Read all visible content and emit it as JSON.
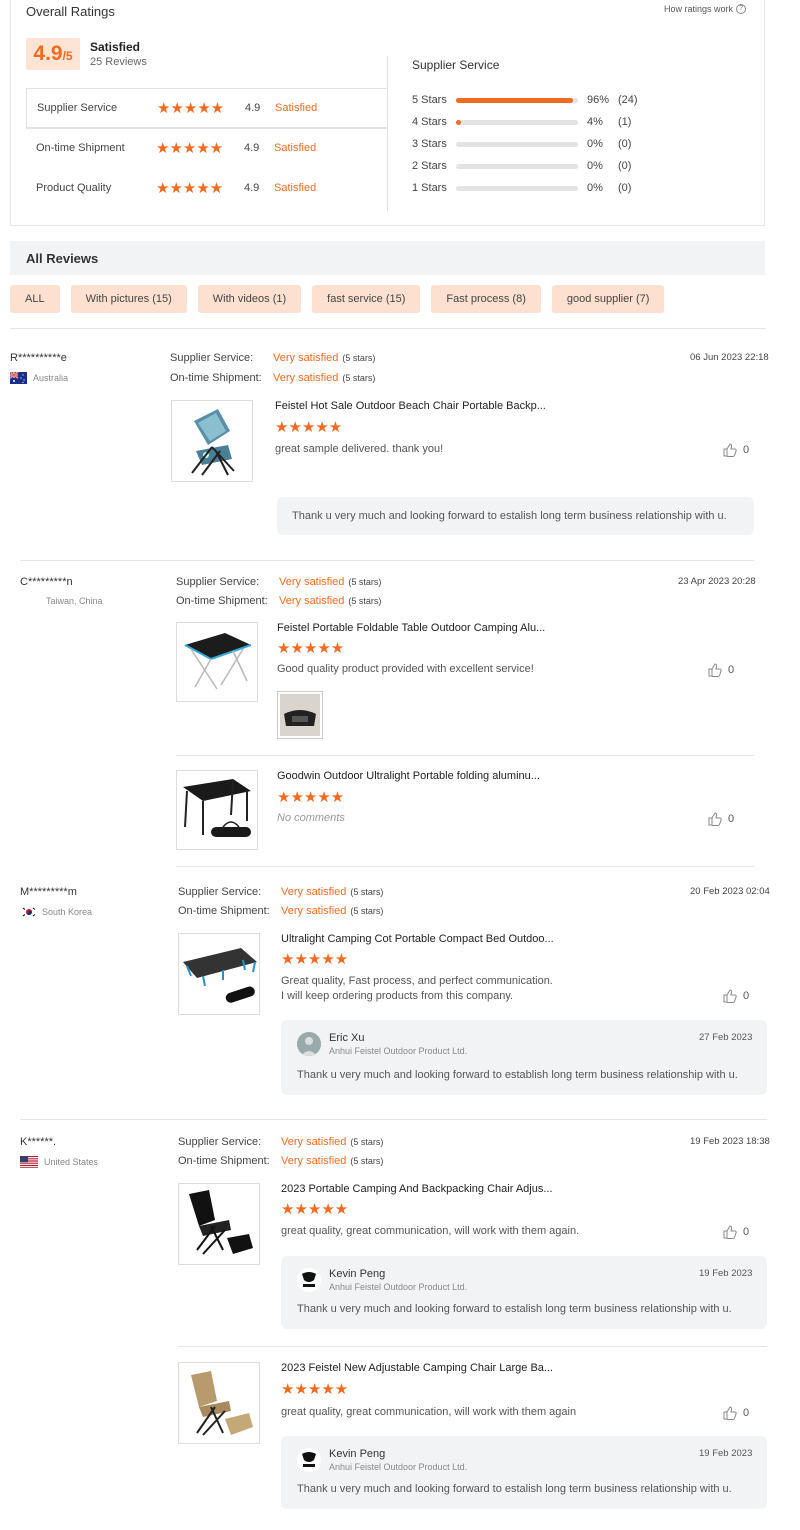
{
  "overall": {
    "title": "Overall Ratings",
    "how_link": "How ratings work",
    "score": "4.9",
    "score_out": "/5",
    "summary": "Satisfied",
    "review_count": "25 Reviews",
    "rows": [
      {
        "label": "Supplier Service",
        "score": "4.9",
        "status": "Satisfied"
      },
      {
        "label": "On-time Shipment",
        "score": "4.9",
        "status": "Satisfied"
      },
      {
        "label": "Product Quality",
        "score": "4.9",
        "status": "Satisfied"
      }
    ]
  },
  "supplier": {
    "title": "Supplier Service",
    "bars": [
      {
        "label": "5 Stars",
        "fraction": 0.96,
        "pct": "96%",
        "count": "(24)"
      },
      {
        "label": "4 Stars",
        "fraction": 0.04,
        "pct": "4%",
        "count": "(1)"
      },
      {
        "label": "3 Stars",
        "fraction": 0,
        "pct": "0%",
        "count": "(0)"
      },
      {
        "label": "2 Stars",
        "fraction": 0,
        "pct": "0%",
        "count": "(0)"
      },
      {
        "label": "1 Stars",
        "fraction": 0,
        "pct": "0%",
        "count": "(0)"
      }
    ]
  },
  "all_reviews": {
    "title": "All Reviews",
    "filters": [
      "ALL",
      "With pictures (15)",
      "With videos (1)",
      "fast service (15)",
      "Fast process (8)",
      "good supplier (7)"
    ]
  },
  "labels": {
    "supplier_service": "Supplier Service:",
    "ontime": "On-time Shipment:",
    "very_satisfied": "Very satisfied",
    "five_stars": "(5 stars)"
  },
  "accent": "#f06b22",
  "reviews": [
    {
      "name": "R**********e",
      "country": "Australia",
      "date": "06 Jun 2023 22:18",
      "products": [
        {
          "title": "Feistel Hot Sale Outdoor Beach Chair Portable Backp...",
          "comment": "great sample delivered. thank you!",
          "likes": "0"
        }
      ],
      "reply": "Thank u very much and looking forward to estalish long term business relationship with u."
    },
    {
      "name": "C*********n",
      "country": "Taiwan, China",
      "date": "23 Apr 2023 20:28",
      "products": [
        {
          "title": "Feistel Portable Foldable Table Outdoor Camping Alu...",
          "comment": "Good quality product provided with excellent service!",
          "likes": "0"
        },
        {
          "title": "Goodwin Outdoor Ultralight Portable folding aluminu...",
          "comment": "No comments",
          "likes": "0"
        }
      ]
    },
    {
      "name": "M*********m",
      "country": "South Korea",
      "date": "20 Feb 2023 02:04",
      "products": [
        {
          "title": "Ultralight Camping Cot Portable Compact Bed Outdoo...",
          "comment_line1": "Great quality, Fast process, and perfect communication.",
          "comment_line2": "I will keep ordering products from this company.",
          "likes": "0"
        }
      ],
      "reply": {
        "name": "Eric Xu",
        "company": "Anhui Feistel Outdoor Product Ltd.",
        "date": "27 Feb 2023",
        "text": "Thank u very much and looking forward to establish long term business relationship with u."
      }
    },
    {
      "name": "K******.",
      "country": "United States",
      "date": "19 Feb 2023 18:38",
      "products": [
        {
          "title": "2023 Portable Camping And Backpacking Chair Adjus...",
          "comment": "great quality, great communication, will work with them again.",
          "likes": "0",
          "reply": {
            "name": "Kevin Peng",
            "company": "Anhui Feistel Outdoor Product Ltd.",
            "date": "19 Feb 2023",
            "text": "Thank u very much and looking forward to estalish long term business relationship with u."
          }
        },
        {
          "title": "2023 Feistel New Adjustable Camping Chair Large Ba...",
          "comment": "great quality, great communication, will work with them again",
          "likes": "0",
          "reply": {
            "name": "Kevin Peng",
            "company": "Anhui Feistel Outdoor Product Ltd.",
            "date": "19 Feb 2023",
            "text": "Thank u very much and looking forward to estalish long term business relationship with u."
          }
        }
      ]
    }
  ]
}
